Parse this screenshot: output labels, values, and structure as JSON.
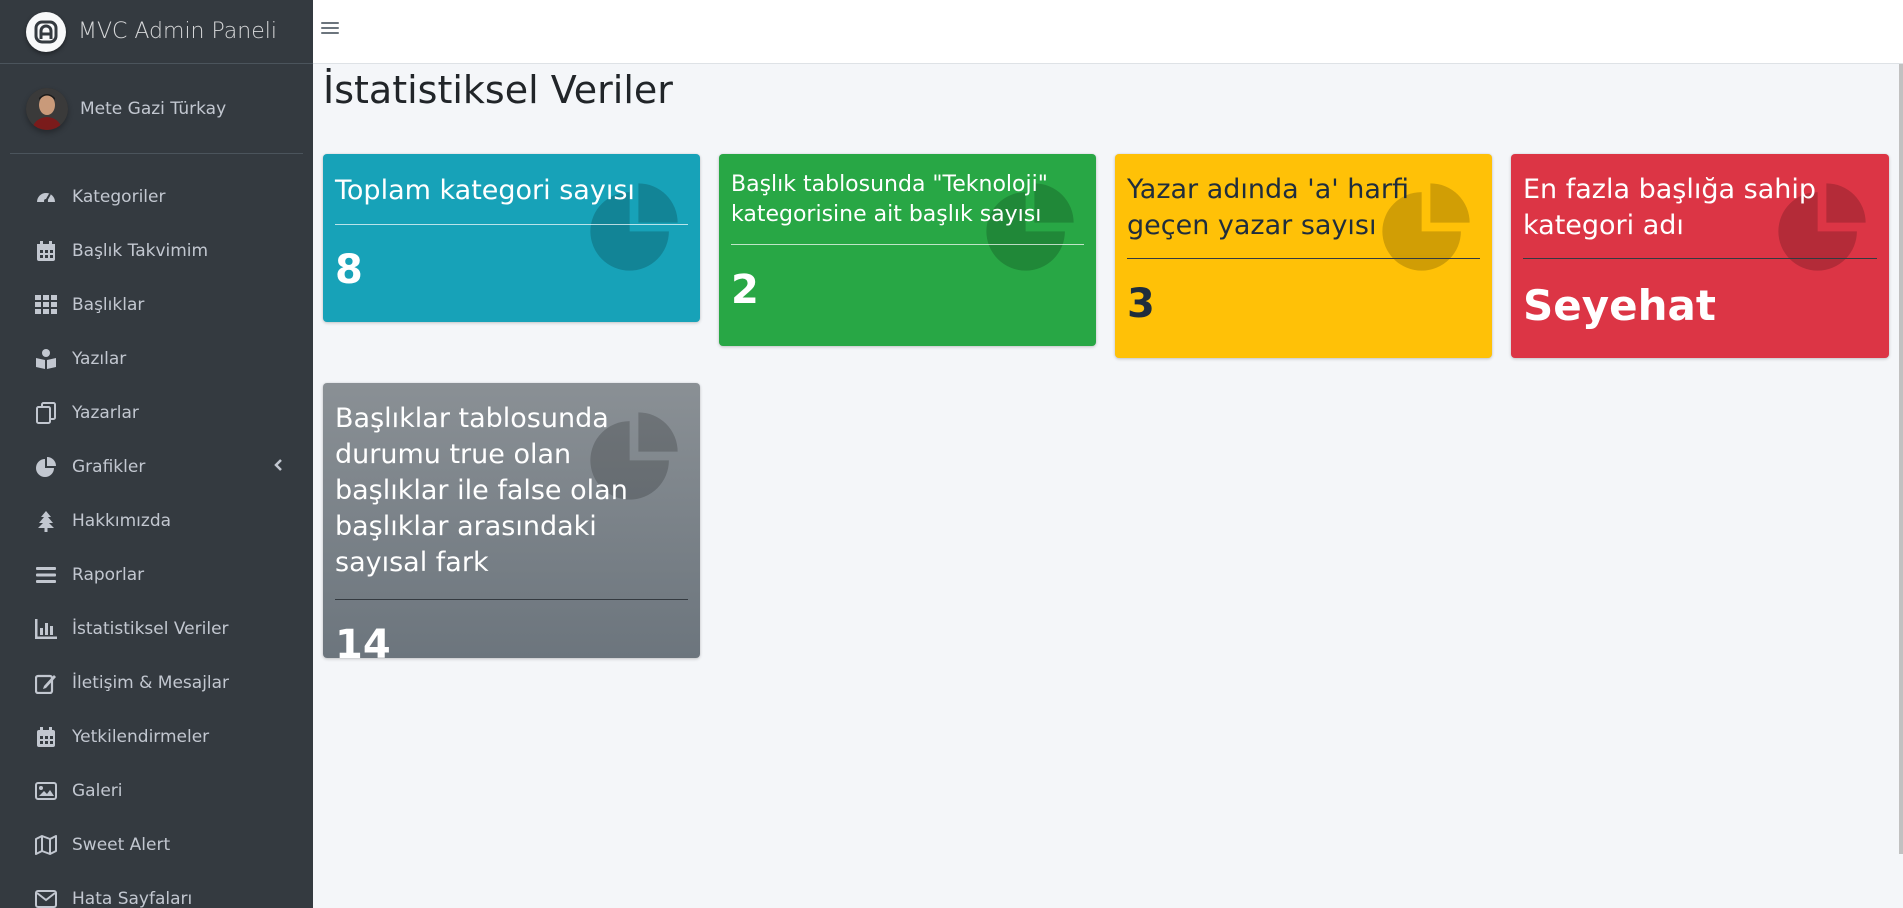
{
  "brand": {
    "name": "MVC Admin Paneli",
    "logo_icon": "admin-logo-icon"
  },
  "user": {
    "name": "Mete Gazi Türkay"
  },
  "sidebar": {
    "items": [
      {
        "label": "Kategoriler",
        "icon": "tachometer-icon"
      },
      {
        "label": "Başlık Takvimim",
        "icon": "calendar-icon"
      },
      {
        "label": "Başlıklar",
        "icon": "grid-icon"
      },
      {
        "label": "Yazılar",
        "icon": "book-reader-icon"
      },
      {
        "label": "Yazarlar",
        "icon": "copy-icon"
      },
      {
        "label": "Grafikler",
        "icon": "pie-chart-icon"
      },
      {
        "label": "Hakkımızda",
        "icon": "tree-icon"
      },
      {
        "label": "Raporlar",
        "icon": "bars-icon"
      },
      {
        "label": "İstatistiksel Veriler",
        "icon": "bar-chart-icon"
      },
      {
        "label": "İletişim & Mesajlar",
        "icon": "edit-icon"
      },
      {
        "label": "Yetkilendirmeler",
        "icon": "calendar-icon"
      },
      {
        "label": "Galeri",
        "icon": "image-icon"
      },
      {
        "label": "Sweet Alert",
        "icon": "map-icon"
      },
      {
        "label": "Hata Sayfaları",
        "icon": "envelope-icon"
      }
    ]
  },
  "page": {
    "title": "İstatistiksel Veriler"
  },
  "cards": [
    {
      "title": "Toplam kategori sayısı",
      "value": "8",
      "color": "#17a2b8"
    },
    {
      "title": "Başlık tablosunda \"Teknoloji\" kategorisine ait başlık sayısı",
      "value": "2",
      "color": "#28a745"
    },
    {
      "title": "Yazar adında 'a' harfi geçen yazar sayısı",
      "value": "3",
      "color": "#ffc107"
    },
    {
      "title": "En fazla başlığa sahip kategori adı",
      "value": "Seyehat",
      "color": "#dc3545"
    },
    {
      "title": "Başlıklar tablosunda durumu true olan başlıklar ile false olan başlıklar arasındaki sayısal fark",
      "value": "14",
      "color": "#6c757d"
    }
  ]
}
